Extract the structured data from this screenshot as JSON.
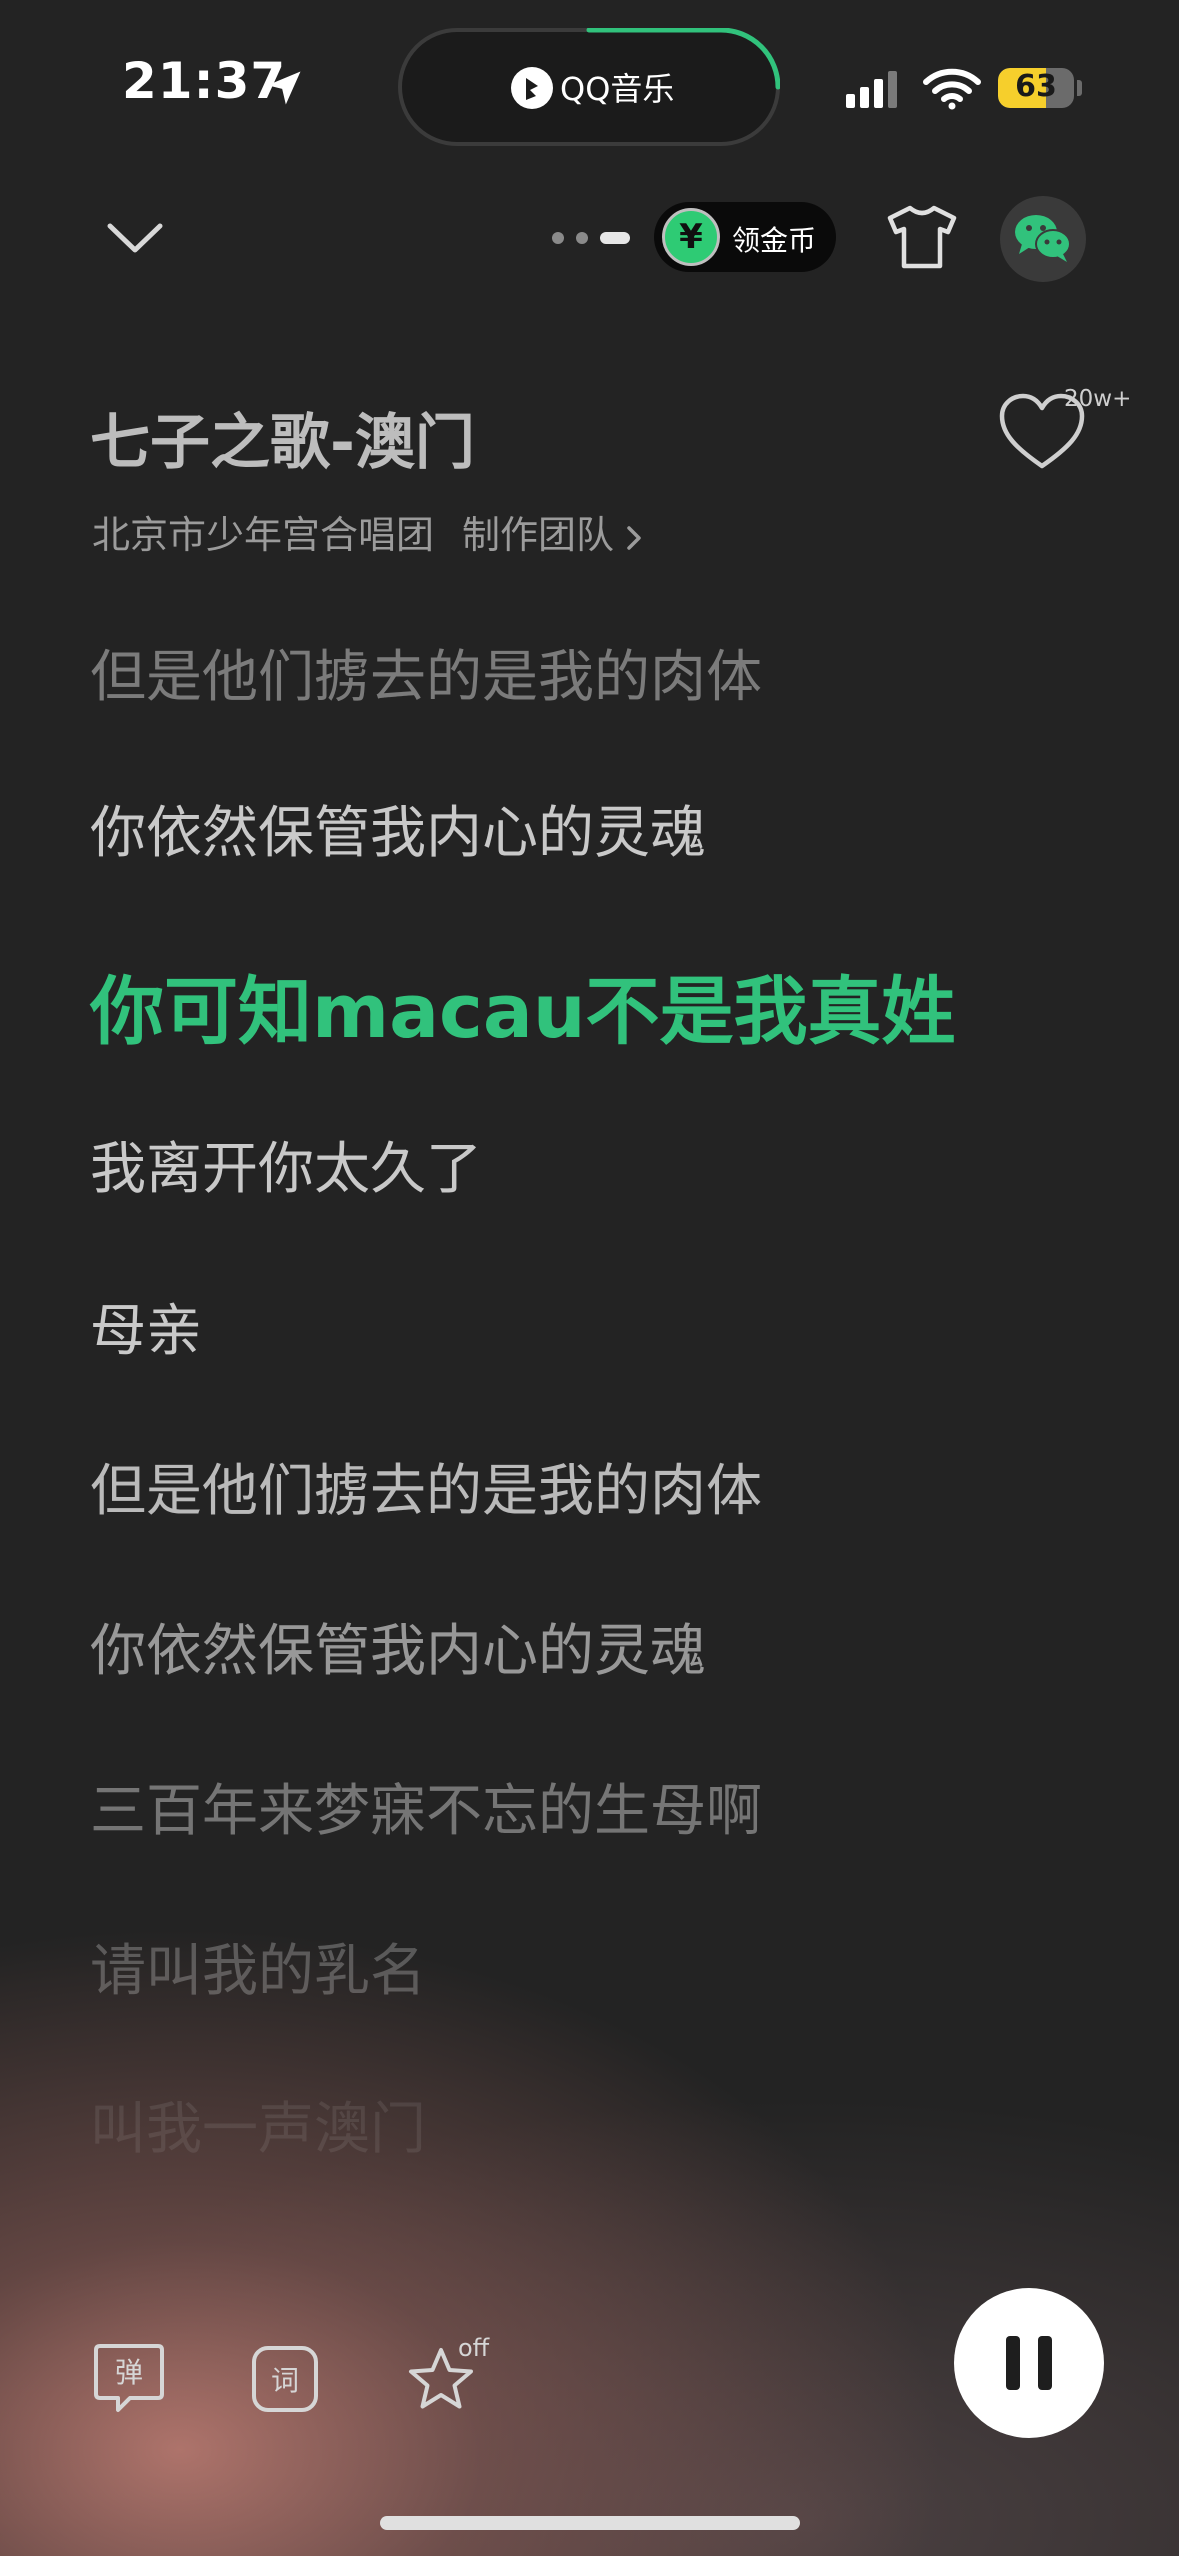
{
  "status_bar": {
    "time": "21:37",
    "battery_level": "63",
    "battery_fraction": 0.63
  },
  "island": {
    "app_name": "QQ音乐",
    "progress_fraction": 0.3
  },
  "header": {
    "coin_symbol": "¥",
    "coin_label": "领金币",
    "page_indicator": {
      "pages": 3,
      "active": 2
    }
  },
  "song": {
    "title": "七子之歌-澳门",
    "artist": "北京市少年宫合唱团",
    "credits_label": "制作团队",
    "like_count": "20w+"
  },
  "lyrics": [
    {
      "text": "但是他们掳去的是我的肉体",
      "opacity": 0.45
    },
    {
      "text": "你依然保管我内心的灵魂",
      "opacity": 0.85
    },
    {
      "text": "你可知macau不是我真姓",
      "active": true
    },
    {
      "text": "我离开你太久了",
      "opacity": 0.85
    },
    {
      "text": "母亲",
      "opacity": 0.85
    },
    {
      "text": "但是他们掳去的是我的肉体",
      "opacity": 0.78
    },
    {
      "text": "你依然保管我内心的灵魂",
      "opacity": 0.6
    },
    {
      "text": "三百年来梦寐不忘的生母啊",
      "opacity": 0.42
    },
    {
      "text": "请叫我的乳名",
      "opacity": 0.28
    },
    {
      "text": "叫我一声澳门",
      "opacity": 0.1
    }
  ],
  "controls": {
    "danmaku_label": "弹",
    "lyrics_label": "词",
    "fav_state": "off"
  },
  "colors": {
    "accent": "#31c27c",
    "background": "#232323",
    "battery": "#f6cf2c"
  }
}
